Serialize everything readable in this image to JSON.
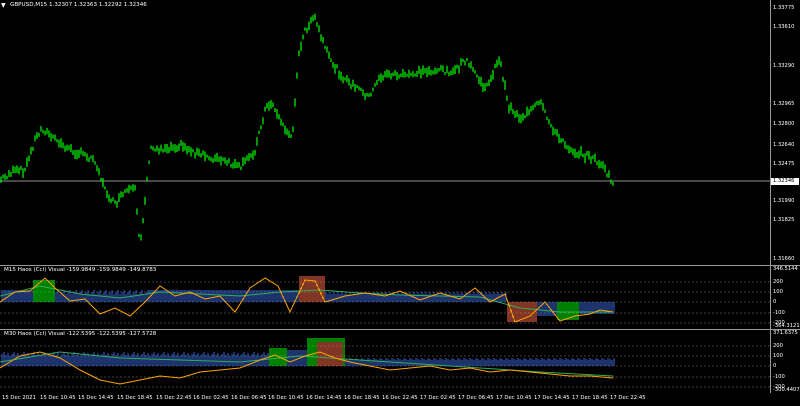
{
  "main": {
    "title": "GBPUSD,M15  1.32307 1.32363 1.32292 1.32346",
    "price_ticks": [
      "1.33775",
      "1.33610",
      "1.33290",
      "1.32965",
      "1.32800",
      "1.32640",
      "1.32475",
      "1.32150",
      "1.31990",
      "1.31825",
      "1.31660"
    ],
    "current_price": "1.32346",
    "colors": {
      "candles": "#00ff00",
      "line": "#c0c0c0"
    }
  },
  "ind1": {
    "title": "M15 Haos (Cci) Visual -159.9849 -159.9849 -149.8783",
    "ticks": [
      "346.5144",
      "200",
      "100",
      "0",
      "-100",
      "-200",
      "-364.3121"
    ]
  },
  "ind2": {
    "title": "M30 Haos (Cci) Visual -122.5395 -122.5395 -127.5728",
    "ticks": [
      "371.6375",
      "200",
      "100",
      "0",
      "-100",
      "-200",
      "-300.4407"
    ]
  },
  "time_axis": {
    "labels": [
      "15 Dec 2021",
      "15 Dec 10:45",
      "15 Dec 14:45",
      "15 Dec 18:45",
      "15 Dec 22:45",
      "16 Dec 02:45",
      "16 Dec 06:45",
      "16 Dec 10:45",
      "16 Dec 14:45",
      "16 Dec 18:45",
      "16 Dec 22:45",
      "17 Dec 02:45",
      "17 Dec 06:45",
      "17 Dec 10:45",
      "17 Dec 14:45",
      "17 Dec 18:45",
      "17 Dec 22:45"
    ]
  },
  "colors": {
    "hist_blue": "#3a66d6",
    "hist_green": "#00ff00",
    "hist_red": "#ff6a4a",
    "cci_orange": "#ffa500",
    "signal_green": "#2fae5a",
    "level_line": "#808080"
  }
}
